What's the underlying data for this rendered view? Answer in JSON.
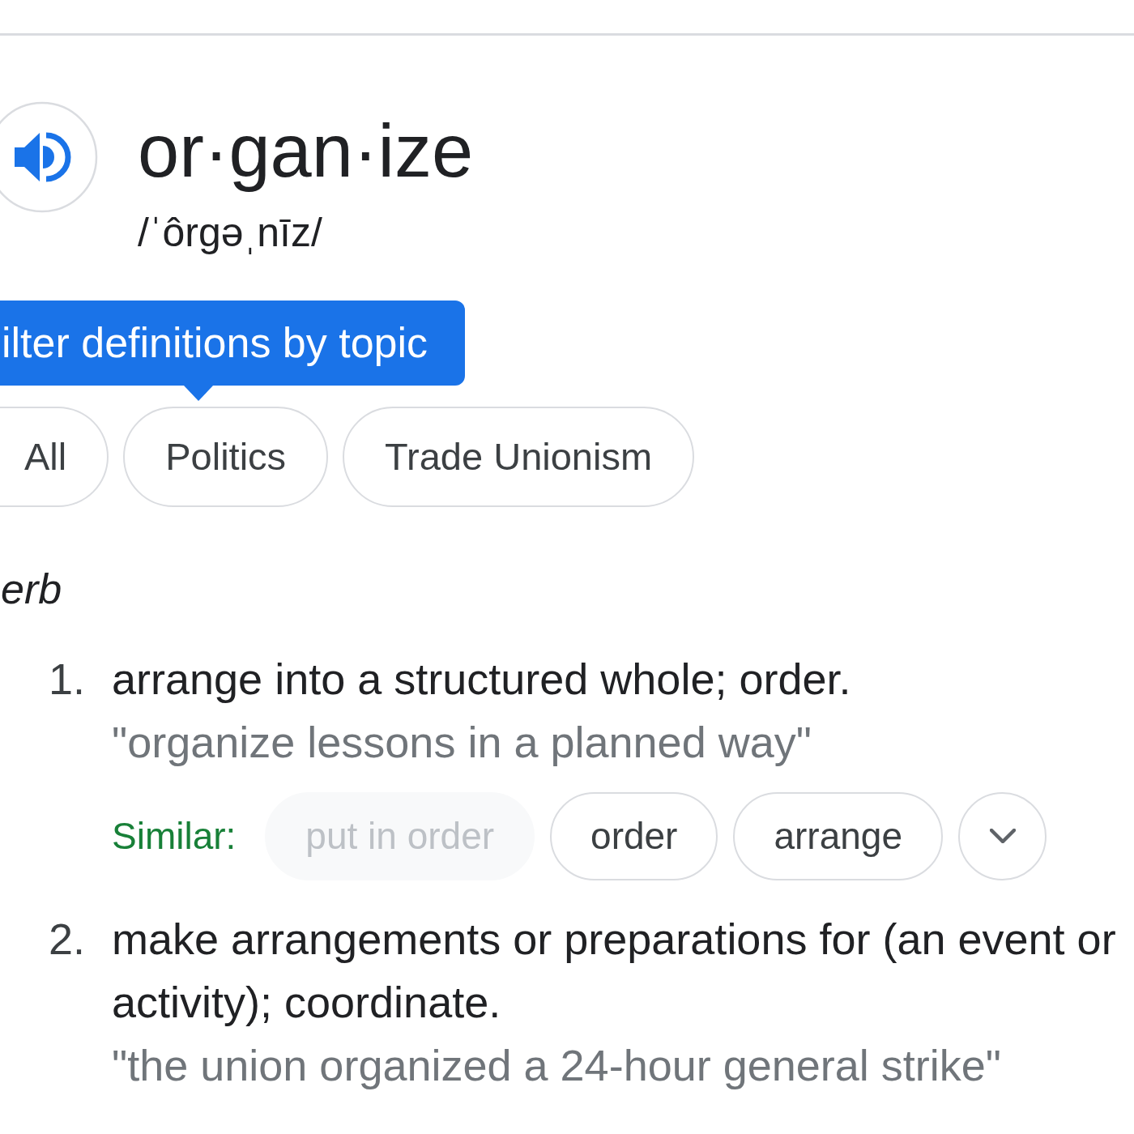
{
  "header": {
    "headword": "or·gan·ize",
    "pronunciation": "/ˈôrgəˌnīz/"
  },
  "topic_filter": {
    "tooltip": "ilter definitions by topic",
    "chips": [
      {
        "label": "All",
        "selected": false
      },
      {
        "label": "Politics",
        "selected": false
      },
      {
        "label": "Trade Unionism",
        "selected": false
      }
    ]
  },
  "part_of_speech": "erb",
  "definitions": [
    {
      "number": "1.",
      "text": "arrange into a structured whole; order.",
      "example": "\"organize lessons in a planned way\"",
      "similar": {
        "label": "Similar:",
        "expanded": false,
        "words": [
          {
            "word": "put in order",
            "disabled": true
          },
          {
            "word": "order",
            "disabled": false
          },
          {
            "word": "arrange",
            "disabled": false
          }
        ]
      }
    },
    {
      "number": "2.",
      "text": "make arrangements or preparations for (an event or activity); coordinate.",
      "example": "\"the union organized a 24-hour general strike\""
    }
  ]
}
